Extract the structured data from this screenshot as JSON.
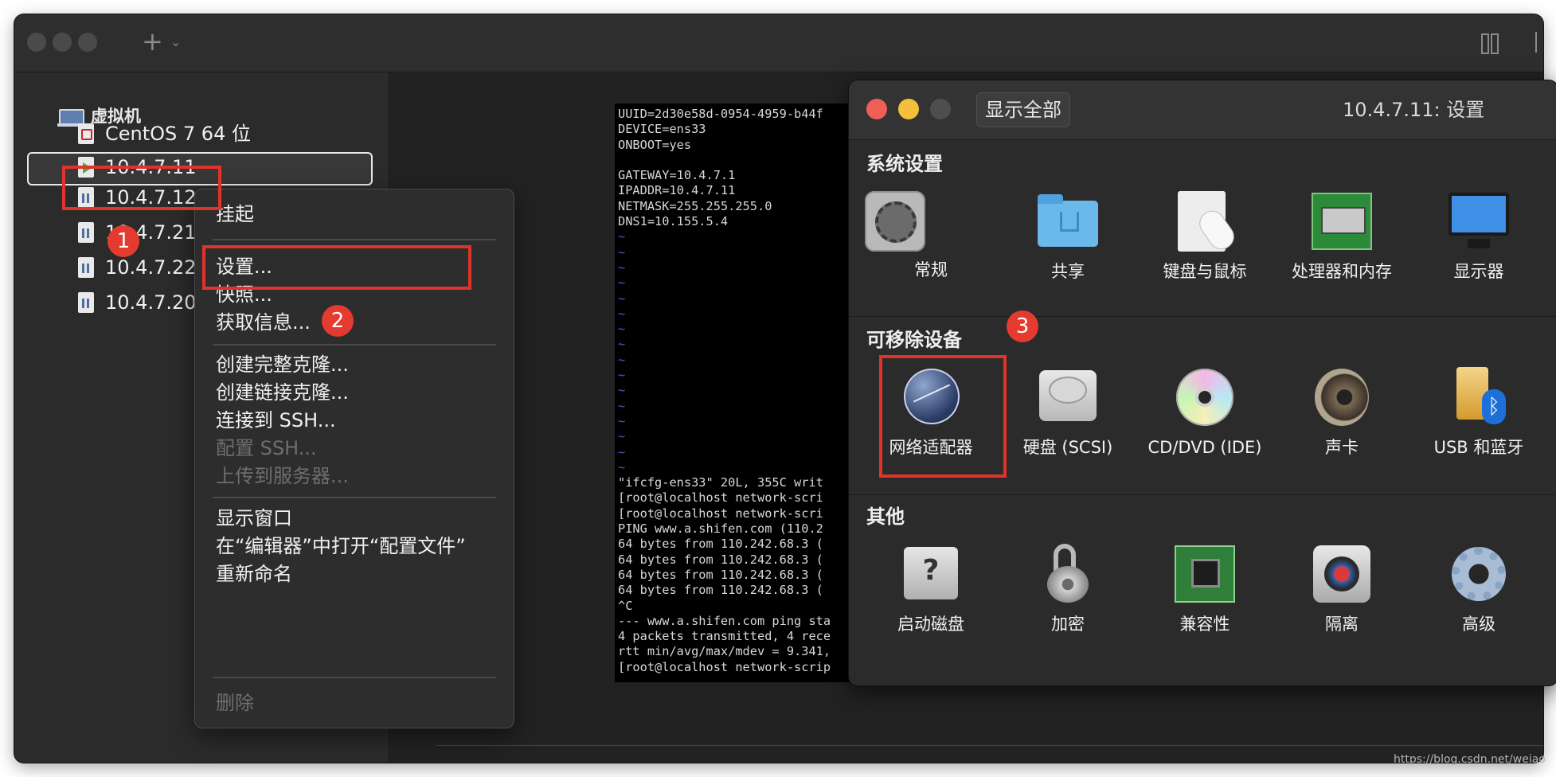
{
  "sidebar": {
    "group_label": "虚拟机",
    "items": [
      {
        "label": "CentOS 7 64 位",
        "icon": "centos-vm-icon"
      },
      {
        "label": "10.4.7.11",
        "icon": "running-vm-icon"
      },
      {
        "label": "10.4.7.12",
        "icon": "paused-vm-icon"
      },
      {
        "label": "10.4.7.21",
        "icon": "paused-vm-icon"
      },
      {
        "label": "10.4.7.22",
        "icon": "paused-vm-icon"
      },
      {
        "label": "10.4.7.200",
        "icon": "paused-vm-icon"
      }
    ]
  },
  "context_menu": {
    "items": [
      {
        "label": "挂起",
        "enabled": true
      },
      {
        "label": "设置...",
        "enabled": true
      },
      {
        "label": "快照...",
        "enabled": true
      },
      {
        "label": "获取信息...",
        "enabled": true
      },
      {
        "label": "创建完整克隆...",
        "enabled": true
      },
      {
        "label": "创建链接克隆...",
        "enabled": true
      },
      {
        "label": "连接到 SSH...",
        "enabled": true
      },
      {
        "label": "配置 SSH...",
        "enabled": false
      },
      {
        "label": "上传到服务器...",
        "enabled": false
      },
      {
        "label": "显示窗口",
        "enabled": true
      },
      {
        "label": "在“编辑器”中打开“配置文件”",
        "enabled": true
      },
      {
        "label": "重新命名",
        "enabled": true
      },
      {
        "label": "删除",
        "enabled": false
      }
    ]
  },
  "terminal": {
    "lines": [
      "UUID=2d30e58d-0954-4959-b44f",
      "DEVICE=ens33",
      "ONBOOT=yes",
      "",
      "GATEWAY=10.4.7.1",
      "IPADDR=10.4.7.11",
      "NETMASK=255.255.255.0",
      "DNS1=10.155.5.4",
      "~",
      "~",
      "~",
      "~",
      "~",
      "~",
      "~",
      "~",
      "~",
      "~",
      "~",
      "~",
      "~",
      "~",
      "~",
      "~",
      "\"ifcfg-ens33\" 20L, 355C writ",
      "[root@localhost network-scri",
      "[root@localhost network-scri",
      "PING www.a.shifen.com (110.2",
      "64 bytes from 110.242.68.3 (",
      "64 bytes from 110.242.68.3 (",
      "64 bytes from 110.242.68.3 (",
      "64 bytes from 110.242.68.3 (",
      "^C",
      "--- www.a.shifen.com ping sta",
      "4 packets transmitted, 4 rece",
      "rtt min/avg/max/mdev = 9.341,",
      "[root@localhost network-scrip"
    ]
  },
  "settings": {
    "show_all": "显示全部",
    "title": "10.4.7.11: 设置",
    "sections": [
      {
        "title": "系统设置",
        "items": [
          {
            "label": "常规",
            "icon": "general-icon"
          },
          {
            "label": "共享",
            "icon": "shared-folder-icon"
          },
          {
            "label": "键盘与鼠标",
            "icon": "keyboard-mouse-icon"
          },
          {
            "label": "处理器和内存",
            "icon": "processor-memory-icon"
          },
          {
            "label": "显示器",
            "icon": "display-icon"
          }
        ]
      },
      {
        "title": "可移除设备",
        "items": [
          {
            "label": "网络适配器",
            "icon": "network-adapter-icon"
          },
          {
            "label": "硬盘 (SCSI)",
            "icon": "hard-disk-icon"
          },
          {
            "label": "CD/DVD (IDE)",
            "icon": "cd-dvd-icon"
          },
          {
            "label": "声卡",
            "icon": "sound-card-icon"
          },
          {
            "label": "USB 和蓝牙",
            "icon": "usb-bluetooth-icon"
          }
        ]
      },
      {
        "title": "其他",
        "items": [
          {
            "label": "启动磁盘",
            "icon": "startup-disk-icon"
          },
          {
            "label": "加密",
            "icon": "encryption-icon"
          },
          {
            "label": "兼容性",
            "icon": "compatibility-icon"
          },
          {
            "label": "隔离",
            "icon": "isolation-icon"
          },
          {
            "label": "高级",
            "icon": "advanced-icon"
          }
        ]
      }
    ]
  },
  "annotations": {
    "badge1": "1",
    "badge2": "2",
    "badge3": "3",
    "color": "#e0332a"
  },
  "watermark": "https://blog.csdn.net/weiao"
}
